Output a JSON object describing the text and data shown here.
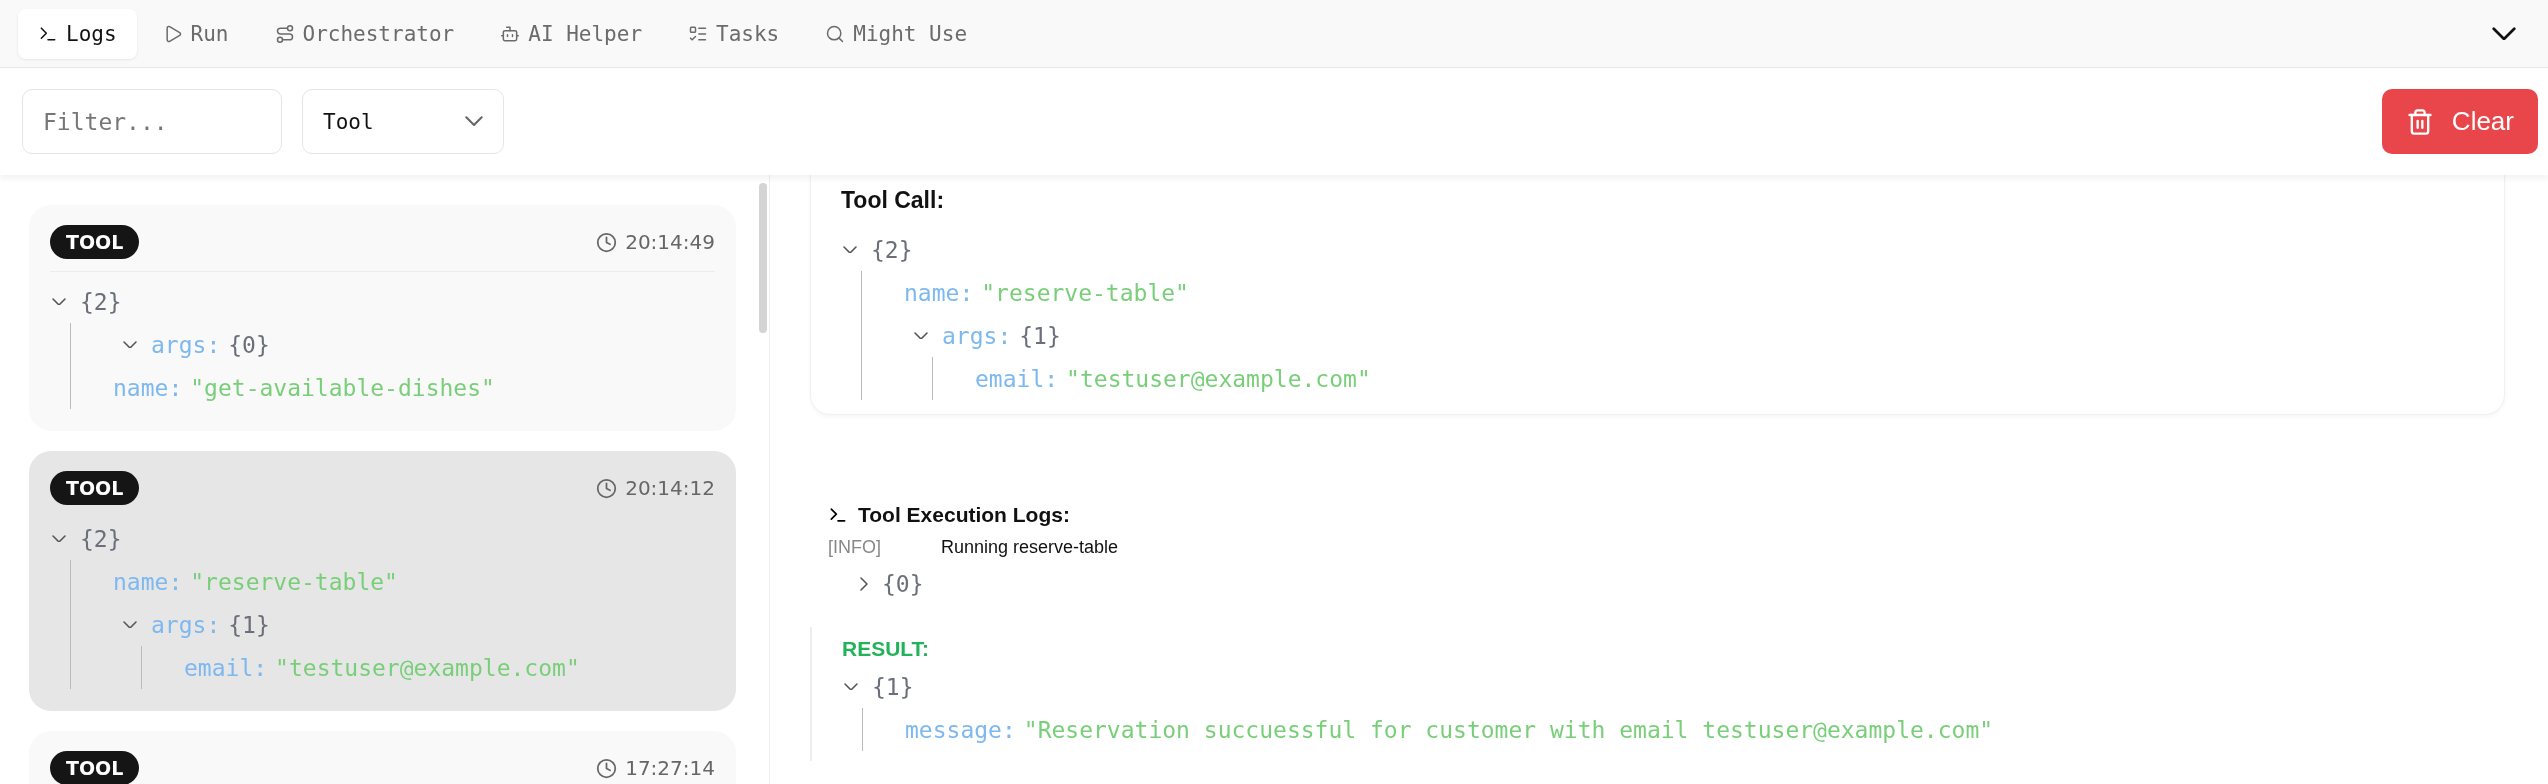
{
  "tabs": [
    {
      "label": "Logs",
      "selected": true
    },
    {
      "label": "Run",
      "selected": false
    },
    {
      "label": "Orchestrator",
      "selected": false
    },
    {
      "label": "AI Helper",
      "selected": false
    },
    {
      "label": "Tasks",
      "selected": false
    },
    {
      "label": "Might Use",
      "selected": false
    }
  ],
  "toolbar": {
    "filter": {
      "placeholder": "Filter..."
    },
    "type_select": {
      "value": "Tool"
    },
    "clear_button": {
      "label": "Clear"
    }
  },
  "cards": [
    {
      "badge": "TOOL",
      "time": "20:14:49",
      "selected": false,
      "tree": [
        {
          "kind": "object",
          "count": "{2}",
          "expanded": true,
          "children": [
            {
              "kind": "object",
              "key": "args:",
              "count": "{0}",
              "expanded": true
            },
            {
              "kind": "pair",
              "key": "name:",
              "value": "\"get-available-dishes\""
            }
          ]
        }
      ]
    },
    {
      "badge": "TOOL",
      "time": "20:14:12",
      "selected": true,
      "tree": [
        {
          "kind": "object",
          "count": "{2}",
          "expanded": true,
          "children": [
            {
              "kind": "pair",
              "key": "name:",
              "value": "\"reserve-table\""
            },
            {
              "kind": "object",
              "key": "args:",
              "count": "{1}",
              "expanded": true,
              "children": [
                {
                  "kind": "pair",
                  "key": "email:",
                  "value": "\"testuser@example.com\""
                }
              ]
            }
          ]
        }
      ]
    },
    {
      "badge": "TOOL",
      "time": "17:27:14",
      "selected": false
    }
  ],
  "detail": {
    "tool_call": {
      "title": "Tool Call:",
      "tree": [
        {
          "kind": "object",
          "count": "{2}",
          "expanded": true,
          "children": [
            {
              "kind": "pair",
              "key": "name:",
              "value": "\"reserve-table\""
            },
            {
              "kind": "object",
              "key": "args:",
              "count": "{1}",
              "expanded": true,
              "children": [
                {
                  "kind": "pair",
                  "key": "email:",
                  "value": "\"testuser@example.com\""
                }
              ]
            }
          ]
        }
      ]
    },
    "execution_logs": {
      "title": "Tool Execution Logs:",
      "entries": [
        {
          "level": "[INFO]",
          "message": "Running reserve-table",
          "tree": [
            {
              "kind": "object",
              "count": "{0}",
              "expanded": false
            }
          ]
        }
      ]
    },
    "result": {
      "label": "RESULT:",
      "tree": [
        {
          "kind": "object",
          "count": "{1}",
          "expanded": true,
          "children": [
            {
              "kind": "pair",
              "key": "message:",
              "value": "\"Reservation succuessful for customer with email testuser@example.com\""
            }
          ]
        }
      ]
    }
  }
}
